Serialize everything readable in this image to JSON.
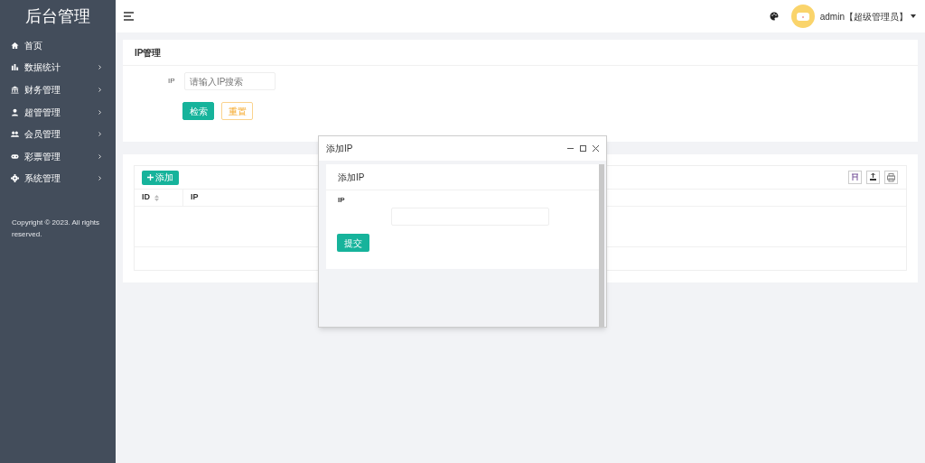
{
  "sidebar": {
    "logo": "后台管理",
    "items": [
      {
        "label": "首页",
        "kind": "link"
      },
      {
        "label": "数据统计",
        "kind": "group"
      },
      {
        "label": "财务管理",
        "kind": "group"
      },
      {
        "label": "超管管理",
        "kind": "group"
      },
      {
        "label": "会员管理",
        "kind": "group"
      },
      {
        "label": "彩票管理",
        "kind": "group"
      },
      {
        "label": "系统管理",
        "kind": "group"
      }
    ],
    "copyright": "Copyright © 2023. All rights reserved."
  },
  "header": {
    "user": "admin【超级管理员】"
  },
  "search_panel": {
    "title": "IP管理",
    "field_label": "IP",
    "placeholder": "请输入IP搜索",
    "buttons": [
      {
        "kind": "primary",
        "label": "检索"
      },
      {
        "kind": "warning",
        "label": "重置"
      }
    ]
  },
  "table": {
    "add_button": "添加",
    "columns": [
      {
        "label": "ID",
        "sortable": true
      },
      {
        "label": "IP",
        "sortable": false
      }
    ]
  },
  "dialog": {
    "title": "添加IP",
    "heading": "添加IP",
    "field_label": "IP",
    "submit": "提交"
  }
}
